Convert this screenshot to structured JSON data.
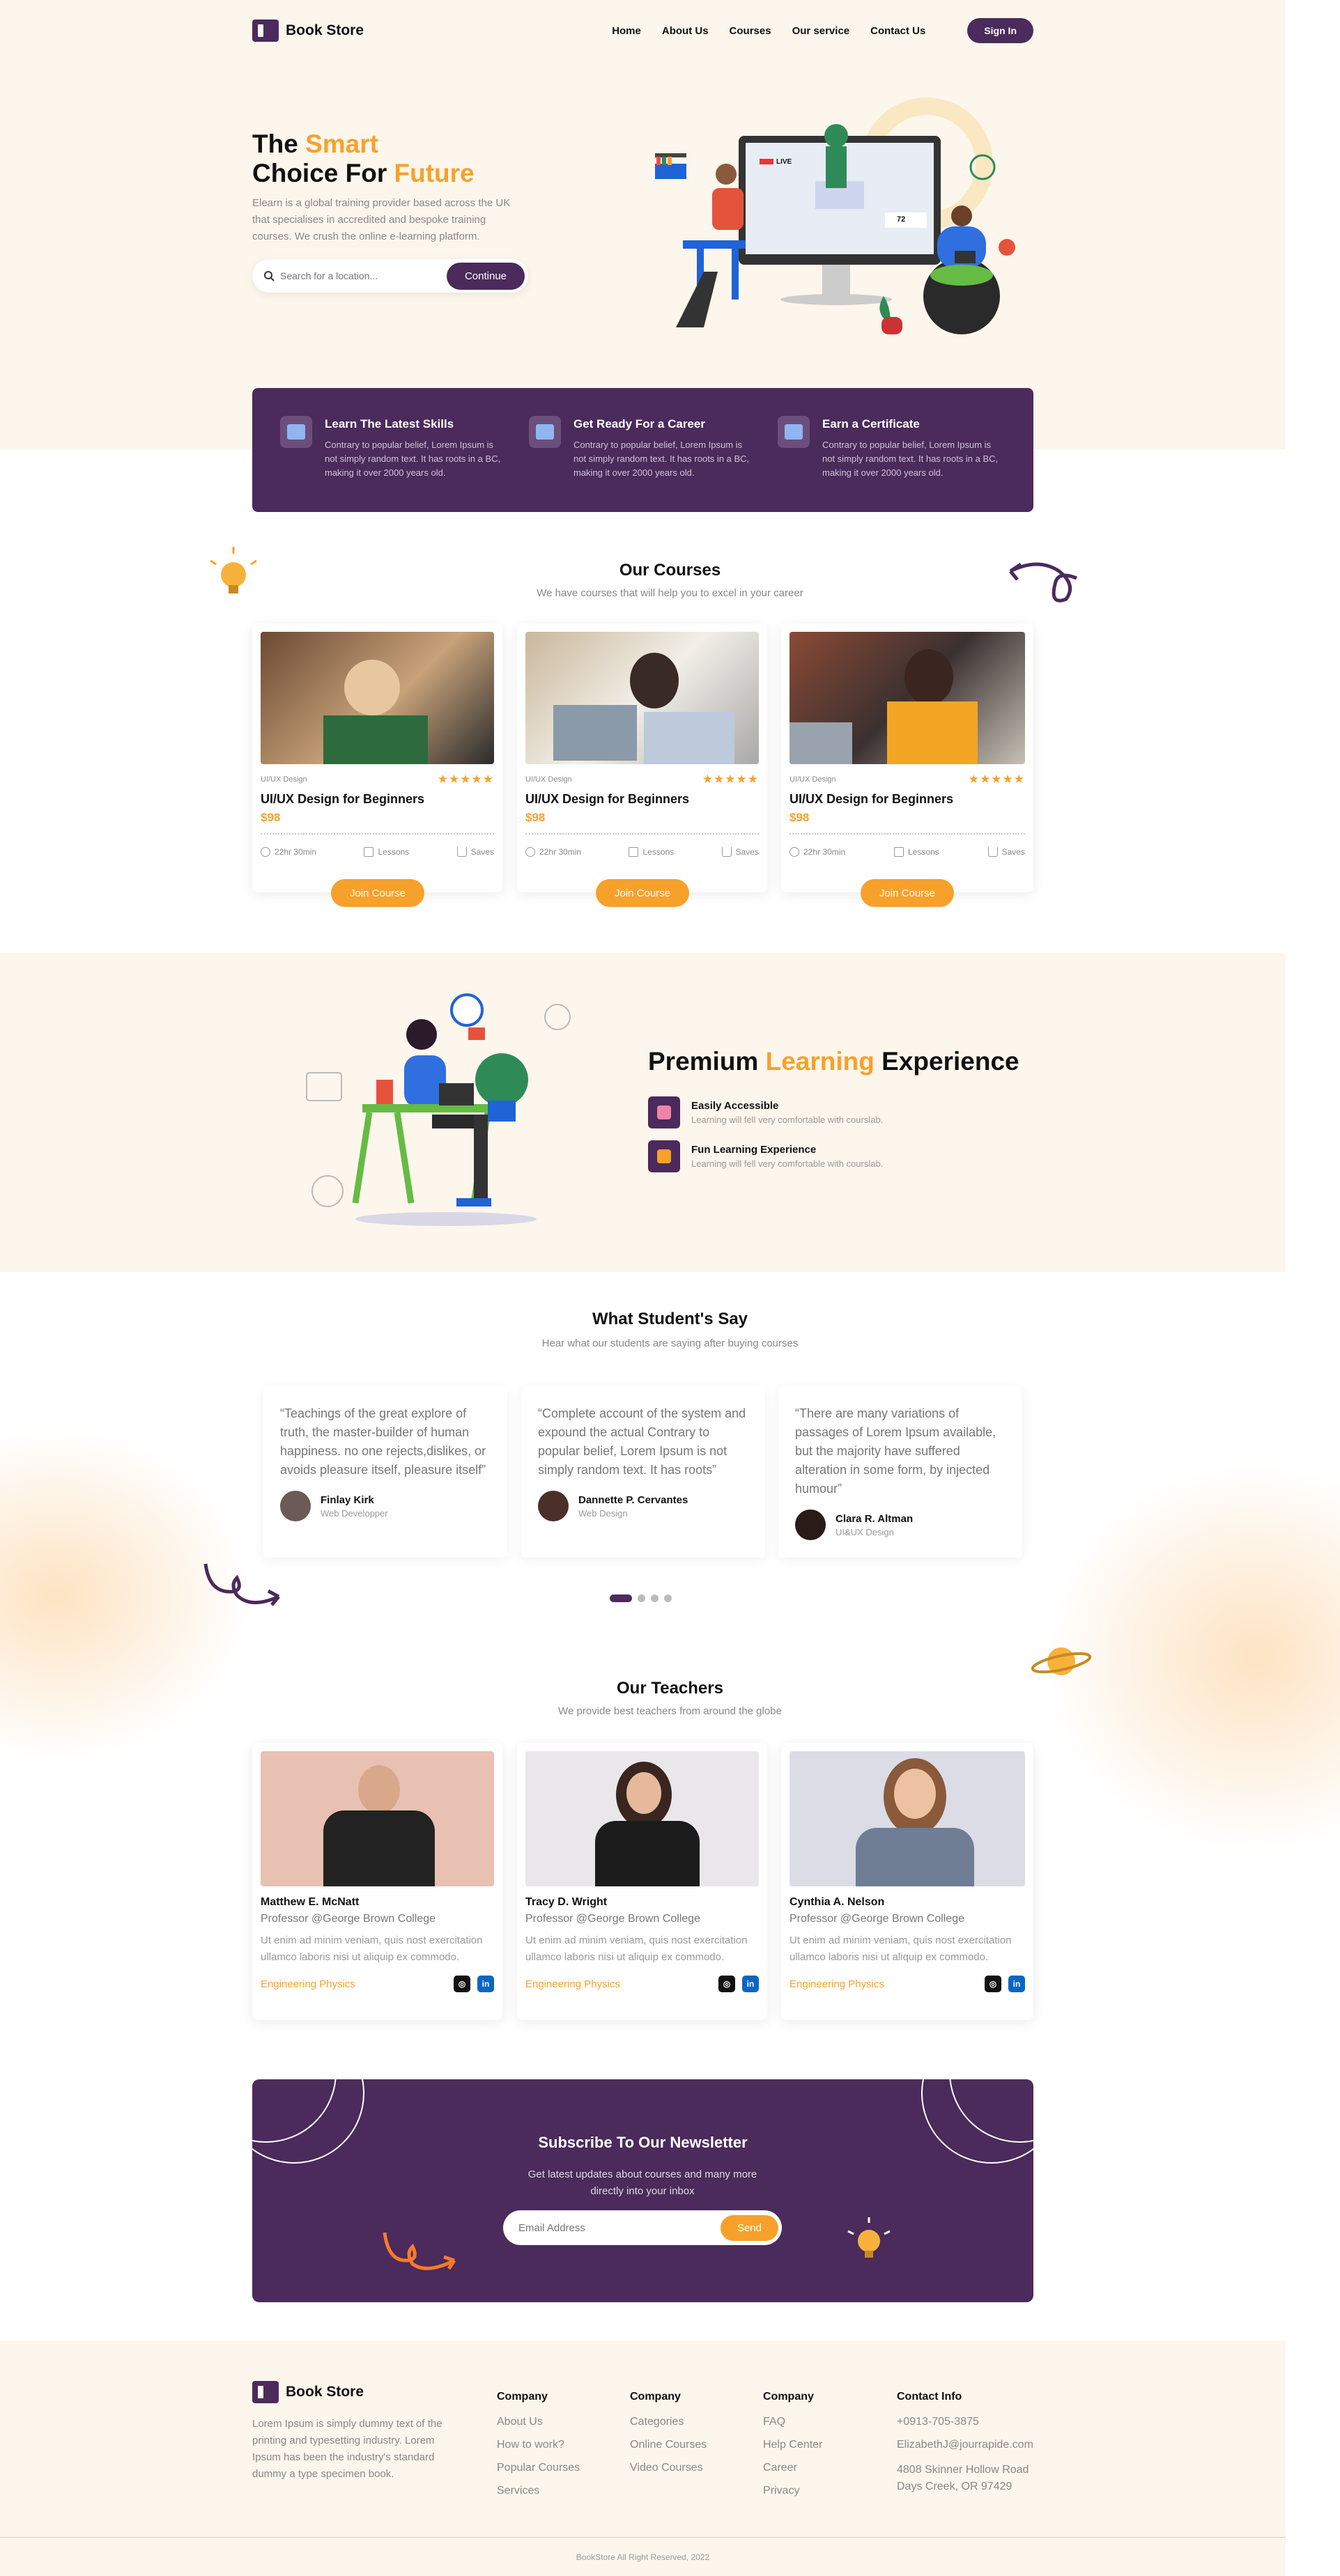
{
  "brand": "Book Store",
  "nav": {
    "items": [
      "Home",
      "About Us",
      "Courses",
      "Our service",
      "Contact Us"
    ],
    "signin": "Sign In"
  },
  "hero": {
    "title_a": "The ",
    "title_b": "Smart",
    "title_c": "Choice For ",
    "title_d": "Future",
    "desc": "Elearn is a global training provider based across the UK that specialises in accredited and bespoke training courses. We crush the online e-learning platform.",
    "search_placeholder": "Search for a location...",
    "button": "Continue",
    "live": "LIVE",
    "viewers": "72"
  },
  "features": [
    {
      "title": "Learn The Latest Skills",
      "text": "Contrary to popular belief, Lorem Ipsum is not simply random text. It has roots in a BC, making it over 2000 years old."
    },
    {
      "title": "Get Ready For a Career",
      "text": "Contrary to popular belief, Lorem Ipsum is not simply random text. It has roots in a BC, making it over 2000 years old."
    },
    {
      "title": "Earn a Certificate",
      "text": "Contrary to popular belief, Lorem Ipsum is not simply random text. It has roots in a BC, making it over 2000 years old."
    }
  ],
  "courses": {
    "title": "Our Courses",
    "subtitle": "We have courses that will help you to excel in your career",
    "items": [
      {
        "category": "UI/UX Design",
        "stars": "★★★★★",
        "title": "UI/UX Design for Beginners",
        "price": "$98",
        "time": "22hr 30min",
        "lessons": "Lessons",
        "saves": "Saves",
        "button": "Join Course"
      },
      {
        "category": "UI/UX Design",
        "stars": "★★★★★",
        "title": "UI/UX Design for Beginners",
        "price": "$98",
        "time": "22hr 30min",
        "lessons": "Lessons",
        "saves": "Saves",
        "button": "Join Course"
      },
      {
        "category": "UI/UX Design",
        "stars": "★★★★★",
        "title": "UI/UX Design for Beginners",
        "price": "$98",
        "time": "22hr 30min",
        "lessons": "Lessons",
        "saves": "Saves",
        "button": "Join Course"
      }
    ]
  },
  "premium": {
    "title_a": "Premium ",
    "title_b": "Learning",
    "title_c": " Experience",
    "items": [
      {
        "title": "Easily Accessible",
        "text": "Learning will fell very comfortable with courslab."
      },
      {
        "title": "Fun Learning Experience",
        "text": "Learning will fell very comfortable with courslab."
      }
    ]
  },
  "testimonials": {
    "title": "What Student's Say",
    "subtitle": "Hear what our students are saying after buying courses",
    "items": [
      {
        "quote": "“Teachings of the great explore of truth, the master-builder of human happiness. no one rejects,dislikes, or avoids pleasure itself, pleasure itself”",
        "name": "Finlay Kirk",
        "role": "Web Developper"
      },
      {
        "quote": "“Complete account of the system and expound the actual Contrary to popular belief, Lorem Ipsum is not simply random text. It has roots”",
        "name": "Dannette P. Cervantes",
        "role": "Web Design"
      },
      {
        "quote": "“There are many variations of passages of Lorem Ipsum available, but the majority have suffered alteration in some form, by injected humour”",
        "name": "Clara R. Altman",
        "role": "UI&UX Design"
      }
    ]
  },
  "teachers": {
    "title": "Our Teachers",
    "subtitle": "We provide best teachers from around the globe",
    "items": [
      {
        "name": "Matthew E. McNatt",
        "position": "Professor @George Brown College",
        "desc": "Ut enim ad minim veniam, quis nost exercitation ullamco laboris nisi ut aliquip ex commodo.",
        "field": "Engineering Physics"
      },
      {
        "name": "Tracy D. Wright",
        "position": "Professor @George Brown College",
        "desc": "Ut enim ad minim veniam, quis nost exercitation ullamco laboris nisi ut aliquip ex commodo.",
        "field": "Engineering Physics"
      },
      {
        "name": "Cynthia A. Nelson",
        "position": "Professor @George Brown College",
        "desc": "Ut enim ad minim veniam, quis nost exercitation ullamco laboris nisi ut aliquip ex commodo.",
        "field": "Engineering Physics"
      }
    ]
  },
  "newsletter": {
    "title": "Subscribe To Our Newsletter",
    "text": "Get latest updates about courses and many more directly into your inbox",
    "placeholder": "Email Address",
    "button": "Send"
  },
  "footer": {
    "about": "Lorem Ipsum is simply dummy text of the printing and typesetting industry. Lorem Ipsum has been the industry's standard dummy a type specimen book.",
    "col1": {
      "title": "Company",
      "links": [
        "About Us",
        "How to work?",
        "Popular Courses",
        "Services"
      ]
    },
    "col2": {
      "title": "Company",
      "links": [
        "Categories",
        "Online Courses",
        "Video Courses"
      ]
    },
    "col3": {
      "title": "Company",
      "links": [
        "FAQ",
        "Help Center",
        "Career",
        "Privacy"
      ]
    },
    "contact": {
      "title": "Contact Info",
      "phone": "+0913-705-3875",
      "email": "ElizabethJ@jourrapide.com",
      "address": "4808 Skinner Hollow Road Days Creek, OR 97429"
    },
    "copyright": "BookStore All Right Reserved, 2022"
  },
  "colors": {
    "purple": "#4b2a5c",
    "orange": "#f7a12b",
    "cream": "#fdf6ec"
  }
}
